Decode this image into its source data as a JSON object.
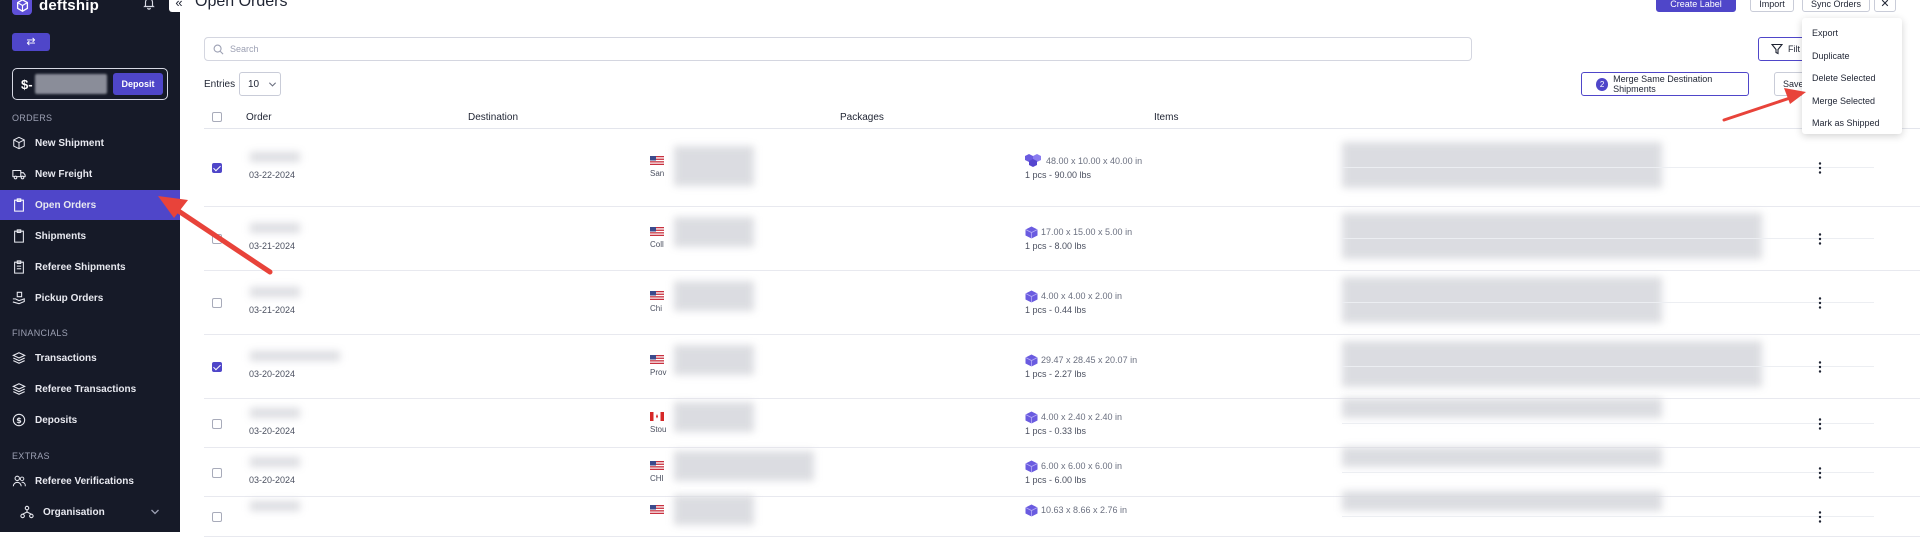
{
  "brand": {
    "name": "deftship"
  },
  "sidebar": {
    "balance_prefix": "$-",
    "deposit_label": "Deposit",
    "sections": {
      "orders": "ORDERS",
      "financials": "FINANCIALS",
      "extras": "EXTRAS"
    },
    "items": [
      {
        "label": "New Shipment",
        "icon": "box-icon"
      },
      {
        "label": "New Freight",
        "icon": "truck-icon"
      },
      {
        "label": "Open Orders",
        "icon": "clipboard-icon",
        "active": true
      },
      {
        "label": "Shipments",
        "icon": "clipboard-icon"
      },
      {
        "label": "Referee Shipments",
        "icon": "clipboard-list-icon"
      },
      {
        "label": "Pickup Orders",
        "icon": "hand-box-icon"
      },
      {
        "label": "Transactions",
        "icon": "layers-icon"
      },
      {
        "label": "Referee Transactions",
        "icon": "layers-icon"
      },
      {
        "label": "Deposits",
        "icon": "dollar-circle-icon"
      },
      {
        "label": "Referee Verifications",
        "icon": "users-icon"
      },
      {
        "label": "Organisation",
        "icon": "org-icon"
      }
    ]
  },
  "header": {
    "title": "Open Orders",
    "create_label": "Create Label",
    "import": "Import",
    "sync_orders": "Sync Orders"
  },
  "dropdown": {
    "items": [
      "Export",
      "Duplicate",
      "Delete Selected",
      "Merge Selected",
      "Mark as Shipped"
    ]
  },
  "toolbar": {
    "search_placeholder": "Search",
    "filter_label": "Filt",
    "entries_label": "Entries",
    "entries_value": "10",
    "merge_count": "2",
    "merge_label": "Merge Same Destination Shipments",
    "save_label": "Save"
  },
  "table": {
    "headers": [
      "Order",
      "Destination",
      "Packages",
      "Items"
    ],
    "rows": [
      {
        "checked": true,
        "date": "03-22-2024",
        "flag": "us",
        "city": "San",
        "dims": "48.00 x 10.00 x 40.00 in",
        "weight": "1 pcs - 90.00 lbs",
        "multi": true
      },
      {
        "checked": false,
        "date": "03-21-2024",
        "flag": "us",
        "city": "Coll",
        "dims": "17.00 x 15.00 x 5.00 in",
        "weight": "1 pcs - 8.00 lbs"
      },
      {
        "checked": false,
        "date": "03-21-2024",
        "flag": "us",
        "city": "Chi",
        "dims": "4.00 x 4.00 x 2.00 in",
        "weight": "1 pcs - 0.44 lbs"
      },
      {
        "checked": true,
        "date": "03-20-2024",
        "flag": "us",
        "city": "Prov",
        "dims": "29.47 x 28.45 x 20.07 in",
        "weight": "1 pcs - 2.27 lbs"
      },
      {
        "checked": false,
        "date": "03-20-2024",
        "flag": "ca",
        "city": "Stou",
        "dims": "4.00 x 2.40 x 2.40 in",
        "weight": "1 pcs - 0.33 lbs"
      },
      {
        "checked": false,
        "date": "03-20-2024",
        "flag": "us",
        "city": "CHI",
        "dims": "6.00 x 6.00 x 6.00 in",
        "weight": "1 pcs - 6.00 lbs"
      },
      {
        "checked": false,
        "date": "",
        "flag": "us",
        "city": "",
        "dims": "10.63 x 8.66 x 2.76 in",
        "weight": ""
      }
    ]
  }
}
